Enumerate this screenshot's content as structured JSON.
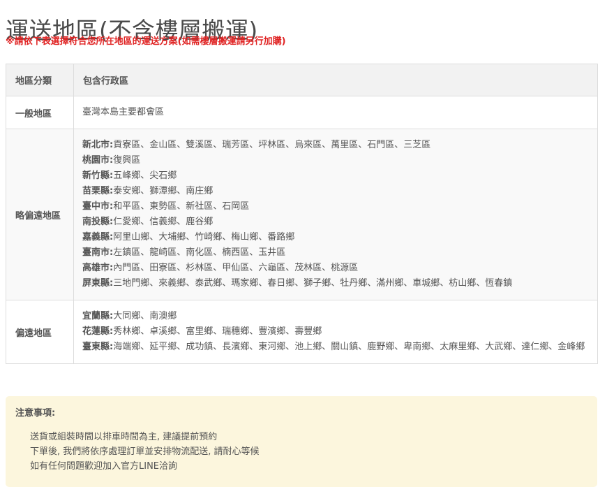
{
  "page": {
    "title": "運送地區(不含樓層搬運)",
    "notice": "※請依下表選擇符合您所在地區的運送方案(如需樓層搬運請另行加購)"
  },
  "table": {
    "headers": [
      "地區分類",
      "包含行政區"
    ],
    "rows": [
      {
        "category": "一般地區",
        "areas": [
          {
            "city": "",
            "districts": "臺灣本島主要都會區"
          }
        ]
      },
      {
        "category": "略偏遠地區",
        "areas": [
          {
            "city": "新北市:",
            "districts": "貢寮區、金山區、雙溪區、瑞芳區、坪林區、烏來區、萬里區、石門區、三芝區"
          },
          {
            "city": "桃園市:",
            "districts": "復興區"
          },
          {
            "city": "新竹縣:",
            "districts": "五峰鄉、尖石鄉"
          },
          {
            "city": "苗栗縣:",
            "districts": "泰安鄉、獅潭鄉、南庄鄉"
          },
          {
            "city": "臺中市:",
            "districts": "和平區、東勢區、新社區、石岡區"
          },
          {
            "city": "南投縣:",
            "districts": "仁愛鄉、信義鄉、鹿谷鄉"
          },
          {
            "city": "嘉義縣:",
            "districts": "阿里山鄉、大埔鄉、竹崎鄉、梅山鄉、番路鄉"
          },
          {
            "city": "臺南市:",
            "districts": "左鎮區、龍崎區、南化區、楠西區、玉井區"
          },
          {
            "city": "高雄市:",
            "districts": "內門區、田寮區、杉林區、甲仙區、六龜區、茂林區、桃源區"
          },
          {
            "city": "屏東縣:",
            "districts": "三地門鄉、來義鄉、泰武鄉、瑪家鄉、春日鄉、獅子鄉、牡丹鄉、滿州鄉、車城鄉、枋山鄉、恆春鎮"
          }
        ]
      },
      {
        "category": "偏遠地區",
        "areas": [
          {
            "city": "宜蘭縣:",
            "districts": "大同鄉、南澳鄉"
          },
          {
            "city": "花蓮縣:",
            "districts": "秀林鄉、卓溪鄉、富里鄉、瑞穗鄉、豐濱鄉、壽豐鄉"
          },
          {
            "city": "臺東縣:",
            "districts": "海端鄉、延平鄉、成功鎮、長濱鄉、東河鄉、池上鄉、關山鎮、鹿野鄉、卑南鄉、太麻里鄉、大武鄉、達仁鄉、金峰鄉"
          }
        ]
      }
    ]
  },
  "notes": {
    "title": "注意事項:",
    "items": [
      "送貨或組裝時間以排車時間為主, 建議提前預約",
      "下單後, 我們將依序處理訂單並安排物流配送, 請耐心等候",
      "如有任何問題歡迎加入官方LINE洽詢"
    ]
  }
}
